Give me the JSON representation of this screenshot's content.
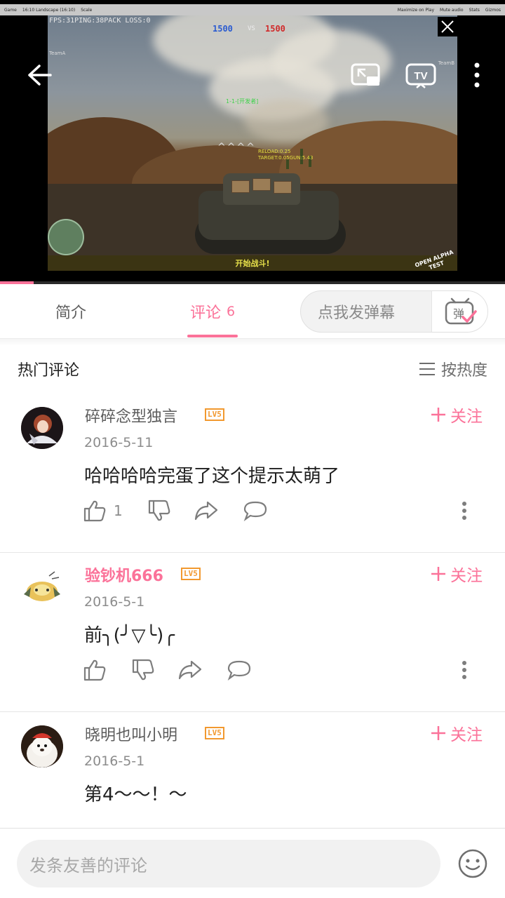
{
  "video": {
    "editor_bar": [
      "Game",
      "16:10 Landscape (16:10)",
      "Scale",
      "Maximize on Play",
      "Mute audio",
      "Stats",
      "Gizmos"
    ],
    "hud": {
      "fps_line": "FPS:31PING:38PACK LOSS:0",
      "team_a_score": "1500",
      "vs_label": "VS",
      "team_b_score": "1500",
      "team_a": "TeamA",
      "team_b": "TeamB",
      "player_tag": "1-1-[开发者]",
      "reload_line": "RELOAD:0.25",
      "target_line": "TARGET:0.05GUN:5.43",
      "start_banner": "开始战斗!",
      "watermark_line1": "OPEN ALPHA",
      "watermark_line2": "TEST"
    },
    "progress_fraction": 0.067,
    "icons": [
      "back-arrow-icon",
      "cast-window-icon",
      "tv-icon",
      "more-vertical-icon"
    ]
  },
  "tabs": {
    "intro_label": "简介",
    "comments_label": "评论",
    "comments_count": "6",
    "danmaku_placeholder": "点我发弹幕",
    "danmaku_button": "弹"
  },
  "comments_section": {
    "title": "热门评论",
    "sort_label": "按热度"
  },
  "comments": [
    {
      "username": "碎碎念型独言",
      "level": "LV5",
      "vip": false,
      "follow_label": "关注",
      "date": "2016-5-11",
      "content": "哈哈哈哈完蛋了这个提示太萌了",
      "likes": "1"
    },
    {
      "username": "验钞机666",
      "level": "LV5",
      "vip": true,
      "follow_label": "关注",
      "date": "2016-5-1",
      "content": "前╮(╯▽╰)╭",
      "likes": ""
    },
    {
      "username": "晓明也叫小明",
      "level": "LV5",
      "vip": false,
      "follow_label": "关注",
      "date": "2016-5-1",
      "content": "第4～～！～",
      "likes": ""
    }
  ],
  "composer": {
    "placeholder": "发条友善的评论"
  },
  "colors": {
    "accent_pink": "#fb7299",
    "level_orange": "#f2992f",
    "muted_text": "#8c8c8c"
  }
}
